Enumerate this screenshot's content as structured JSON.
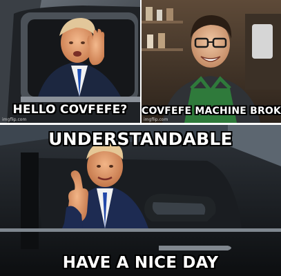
{
  "panels": [
    {
      "caption": "HELLO COVFEFE?",
      "watermark": "imgflip.com"
    },
    {
      "caption": "COVFEFE MACHINE BROKE",
      "watermark": "imgflip.com"
    },
    {
      "caption_top": "UNDERSTANDABLE",
      "caption_bottom": "HAVE A NICE DAY"
    }
  ]
}
